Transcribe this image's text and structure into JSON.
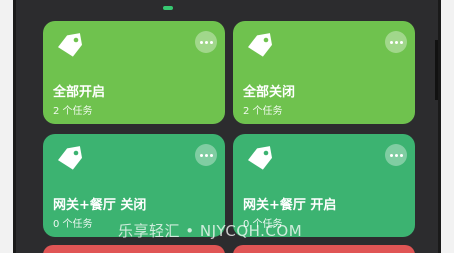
{
  "cards": [
    {
      "icon": "tag-icon",
      "title": "全部开启",
      "subtitle": "2 个任务",
      "color": "#6fc24e"
    },
    {
      "icon": "tag-icon",
      "title": "全部关闭",
      "subtitle": "2 个任务",
      "color": "#6fc24e"
    },
    {
      "icon": "tag-icon",
      "title": "网关+餐厅 关闭",
      "subtitle": "0 个任务",
      "color": "#3cb371"
    },
    {
      "icon": "tag-icon",
      "title": "网关+餐厅 开启",
      "subtitle": "0 个任务",
      "color": "#3cb371"
    }
  ],
  "partial_cards_color": "#e05555",
  "watermark": "乐享轻汇 • NJYCQH.COM"
}
